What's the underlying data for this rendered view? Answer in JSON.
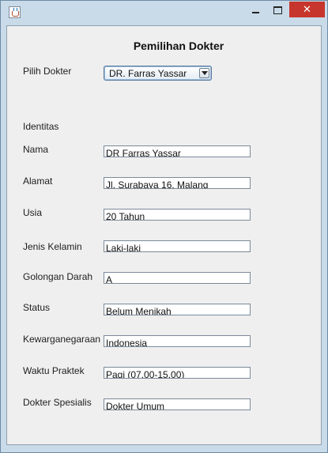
{
  "window": {
    "icon": "java-cup-icon",
    "controls": {
      "minimize": "minimize-icon",
      "maximize": "maximize-icon",
      "close_label": "✕"
    }
  },
  "form": {
    "heading": "Pemilihan Dokter",
    "pilih_label": "Pilih Dokter",
    "doctor_selected": "DR. Farras Yassar",
    "section_label": "Identitas",
    "fields": [
      {
        "label": "Nama",
        "value": "DR Farras Yassar"
      },
      {
        "label": "Alamat",
        "value": "Jl. Surabaya 16, Malang"
      },
      {
        "label": "Usia",
        "value": "20 Tahun"
      },
      {
        "label": "Jenis Kelamin",
        "value": "Laki-laki"
      },
      {
        "label": "Golongan Darah",
        "value": "A"
      },
      {
        "label": "Status",
        "value": "Belum Menikah"
      },
      {
        "label": "Kewarganegaraan",
        "value": "Indonesia"
      },
      {
        "label": "Waktu Praktek",
        "value": "Pagi (07.00-15.00)"
      },
      {
        "label": "Dokter Spesialis",
        "value": "Dokter Umum"
      }
    ]
  },
  "colors": {
    "window_frame": "#c9dbe9",
    "close_button": "#c7362d",
    "panel": "#efefef"
  }
}
